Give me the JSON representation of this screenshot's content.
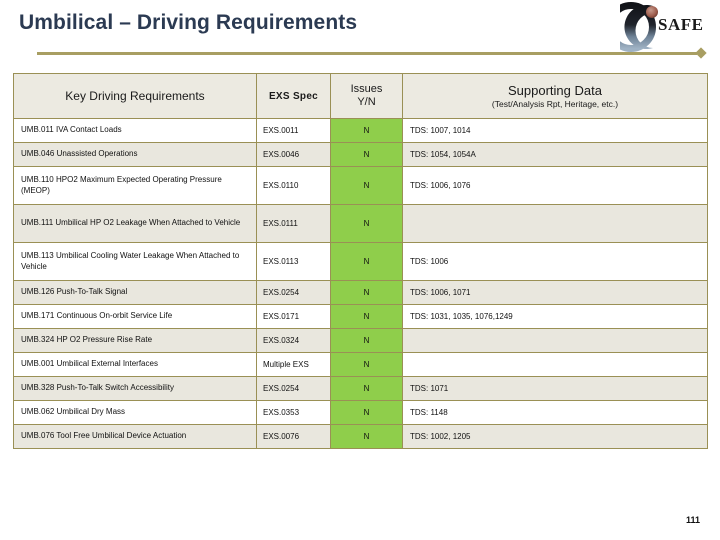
{
  "slide": {
    "title": "Umbilical – Driving Requirements",
    "page_number": "111",
    "logo_text": "SAFE",
    "accent_color": "#a89e62",
    "title_color": "#2b3a52",
    "issue_cell_color": "#8fce4b",
    "header_bg_color": "#eceae1",
    "alt_row_color": "#e9e7de"
  },
  "table": {
    "headers": {
      "key_driving_requirements": "Key Driving Requirements",
      "exs_spec": "EXS Spec",
      "issues": "Issues",
      "issues_sub": "Y/N",
      "supporting_data": "Supporting Data",
      "supporting_data_sub": "(Test/Analysis Rpt, Heritage, etc.)"
    },
    "rows": [
      {
        "requirement": "UMB.011  IVA Contact Loads",
        "exs_spec": "EXS.0011",
        "issues": "N",
        "supporting_data": "TDS: 1007, 1014",
        "tall": false
      },
      {
        "requirement": "UMB.046  Unassisted Operations",
        "exs_spec": "EXS.0046",
        "issues": "N",
        "supporting_data": "TDS: 1054, 1054A",
        "tall": false
      },
      {
        "requirement": "UMB.110  HPO2 Maximum Expected Operating Pressure (MEOP)",
        "exs_spec": "EXS.0110",
        "issues": "N",
        "supporting_data": "TDS: 1006, 1076",
        "tall": true
      },
      {
        "requirement": "UMB.111  Umbilical HP O2 Leakage When Attached to Vehicle",
        "exs_spec": "EXS.0111",
        "issues": "N",
        "supporting_data": "",
        "tall": true
      },
      {
        "requirement": "UMB.113  Umbilical Cooling Water Leakage When Attached to Vehicle",
        "exs_spec": "EXS.0113",
        "issues": "N",
        "supporting_data": "TDS: 1006",
        "tall": true
      },
      {
        "requirement": "UMB.126  Push-To-Talk Signal",
        "exs_spec": "EXS.0254",
        "issues": "N",
        "supporting_data": "TDS: 1006, 1071",
        "tall": false
      },
      {
        "requirement": "UMB.171  Continuous On-orbit Service Life",
        "exs_spec": "EXS.0171",
        "issues": "N",
        "supporting_data": "TDS: 1031,  1035, 1076,1249",
        "tall": false
      },
      {
        "requirement": "UMB.324  HP O2 Pressure Rise Rate",
        "exs_spec": "EXS.0324",
        "issues": "N",
        "supporting_data": "",
        "tall": false
      },
      {
        "requirement": "UMB.001  Umbilical External Interfaces",
        "exs_spec": "Multiple EXS",
        "issues": "N",
        "supporting_data": "",
        "tall": false
      },
      {
        "requirement": "UMB.328   Push-To-Talk Switch Accessibility",
        "exs_spec": "EXS.0254",
        "issues": "N",
        "supporting_data": "TDS: 1071",
        "tall": false
      },
      {
        "requirement": "UMB.062  Umbilical Dry Mass",
        "exs_spec": "EXS.0353",
        "issues": "N",
        "supporting_data": "TDS: 1148",
        "tall": false
      },
      {
        "requirement": "UMB.076  Tool Free Umbilical Device Actuation",
        "exs_spec": "EXS.0076",
        "issues": "N",
        "supporting_data": "TDS: 1002, 1205",
        "tall": false
      }
    ]
  }
}
